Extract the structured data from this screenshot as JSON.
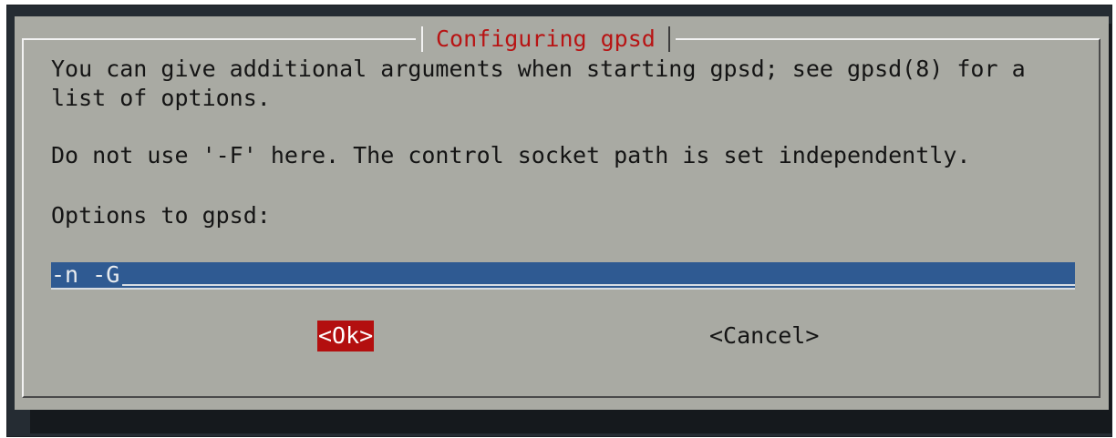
{
  "dialog": {
    "title": "Configuring gpsd",
    "lines": [
      "You can give additional arguments when starting gpsd; see gpsd(8) for a",
      "list of options.",
      "Do not use '-F' here. The control socket path is set independently.",
      "Options to gpsd:"
    ],
    "input_value": "-n -G",
    "ok_label": "<Ok>",
    "cancel_label": "<Cancel>"
  },
  "colors": {
    "background": "#a9aaa3",
    "title": "#b81414",
    "input": "#2f5a92",
    "selected_button": "#b30f0f",
    "terminal_background": "#252c33"
  }
}
